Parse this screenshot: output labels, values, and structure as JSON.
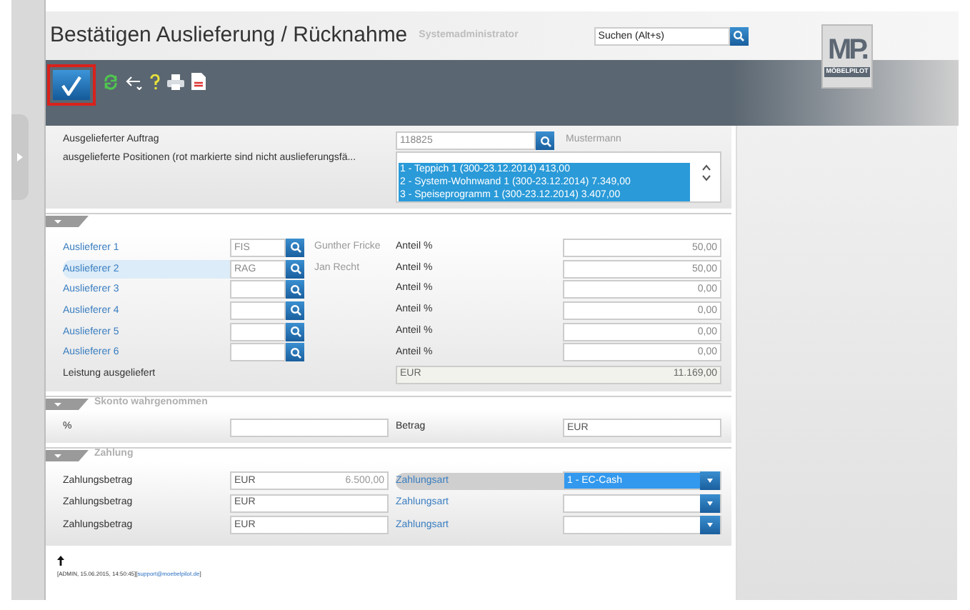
{
  "window": {
    "title": "Bestätigen Auslieferung / Rücknahme",
    "user": "Systemadministrator"
  },
  "search": {
    "placeholder": "Suchen (Alt+s)"
  },
  "logo": {
    "mark": "MP.",
    "name": "MÖBELPILOT"
  },
  "toolbar": {
    "confirm_highlighted": true
  },
  "order": {
    "label": "Ausgelieferter Auftrag",
    "value": "118825",
    "customer": "Mustermann"
  },
  "positions": {
    "label": "ausgelieferte Positionen (rot markierte sind nicht auslieferungsfä...",
    "items": [
      {
        "text": "1 - Teppich 1 (300-23.12.2014) 413,00",
        "selected": true
      },
      {
        "text": "2 - System-Wohnwand 1 (300-23.12.2014) 7.349,00",
        "selected": true
      },
      {
        "text": "3 - Speiseprogramm 1 (300-23.12.2014) 3.407,00",
        "selected": true
      }
    ]
  },
  "deliverers": [
    {
      "label": "Auslieferer 1",
      "code": "FIS",
      "name": "Gunther Fricke",
      "share_label": "Anteil %",
      "share": "50,00",
      "selected": false
    },
    {
      "label": "Auslieferer 2",
      "code": "RAG",
      "name": "Jan Recht",
      "share_label": "Anteil %",
      "share": "50,00",
      "selected": true
    },
    {
      "label": "Auslieferer 3",
      "share_label": "Anteil %",
      "share": "0,00",
      "selected": false
    },
    {
      "label": "Auslieferer 4",
      "share_label": "Anteil %",
      "share": "0,00",
      "selected": false
    },
    {
      "label": "Auslieferer 5",
      "share_label": "Anteil %",
      "share": "0,00",
      "selected": false
    },
    {
      "label": "Auslieferer 6",
      "share_label": "Anteil %",
      "share": "0,00",
      "selected": false
    }
  ],
  "total": {
    "label": "Leistung ausgeliefert",
    "currency": "EUR",
    "value": "11.169,00"
  },
  "skonto": {
    "title": "Skonto wahrgenommen",
    "percent_label": "%",
    "amount_label": "Betrag",
    "amount_currency": "EUR"
  },
  "payment": {
    "title": "Zahlung",
    "rows": [
      {
        "label": "Zahlungsbetrag",
        "currency": "EUR",
        "amount": "6.500,00",
        "type_label": "Zahlungsart",
        "type_value": "1 - EC-Cash",
        "selected": true
      },
      {
        "label": "Zahlungsbetrag",
        "currency": "EUR",
        "type_label": "Zahlungsart",
        "selected": false
      },
      {
        "label": "Zahlungsbetrag",
        "currency": "EUR",
        "type_label": "Zahlungsart",
        "selected": false
      }
    ]
  },
  "footer": {
    "prefix": "[ADMIN, 15.06.2015, 14:50:45][",
    "link": "support@moebelpilot.de",
    "suffix": "]"
  }
}
